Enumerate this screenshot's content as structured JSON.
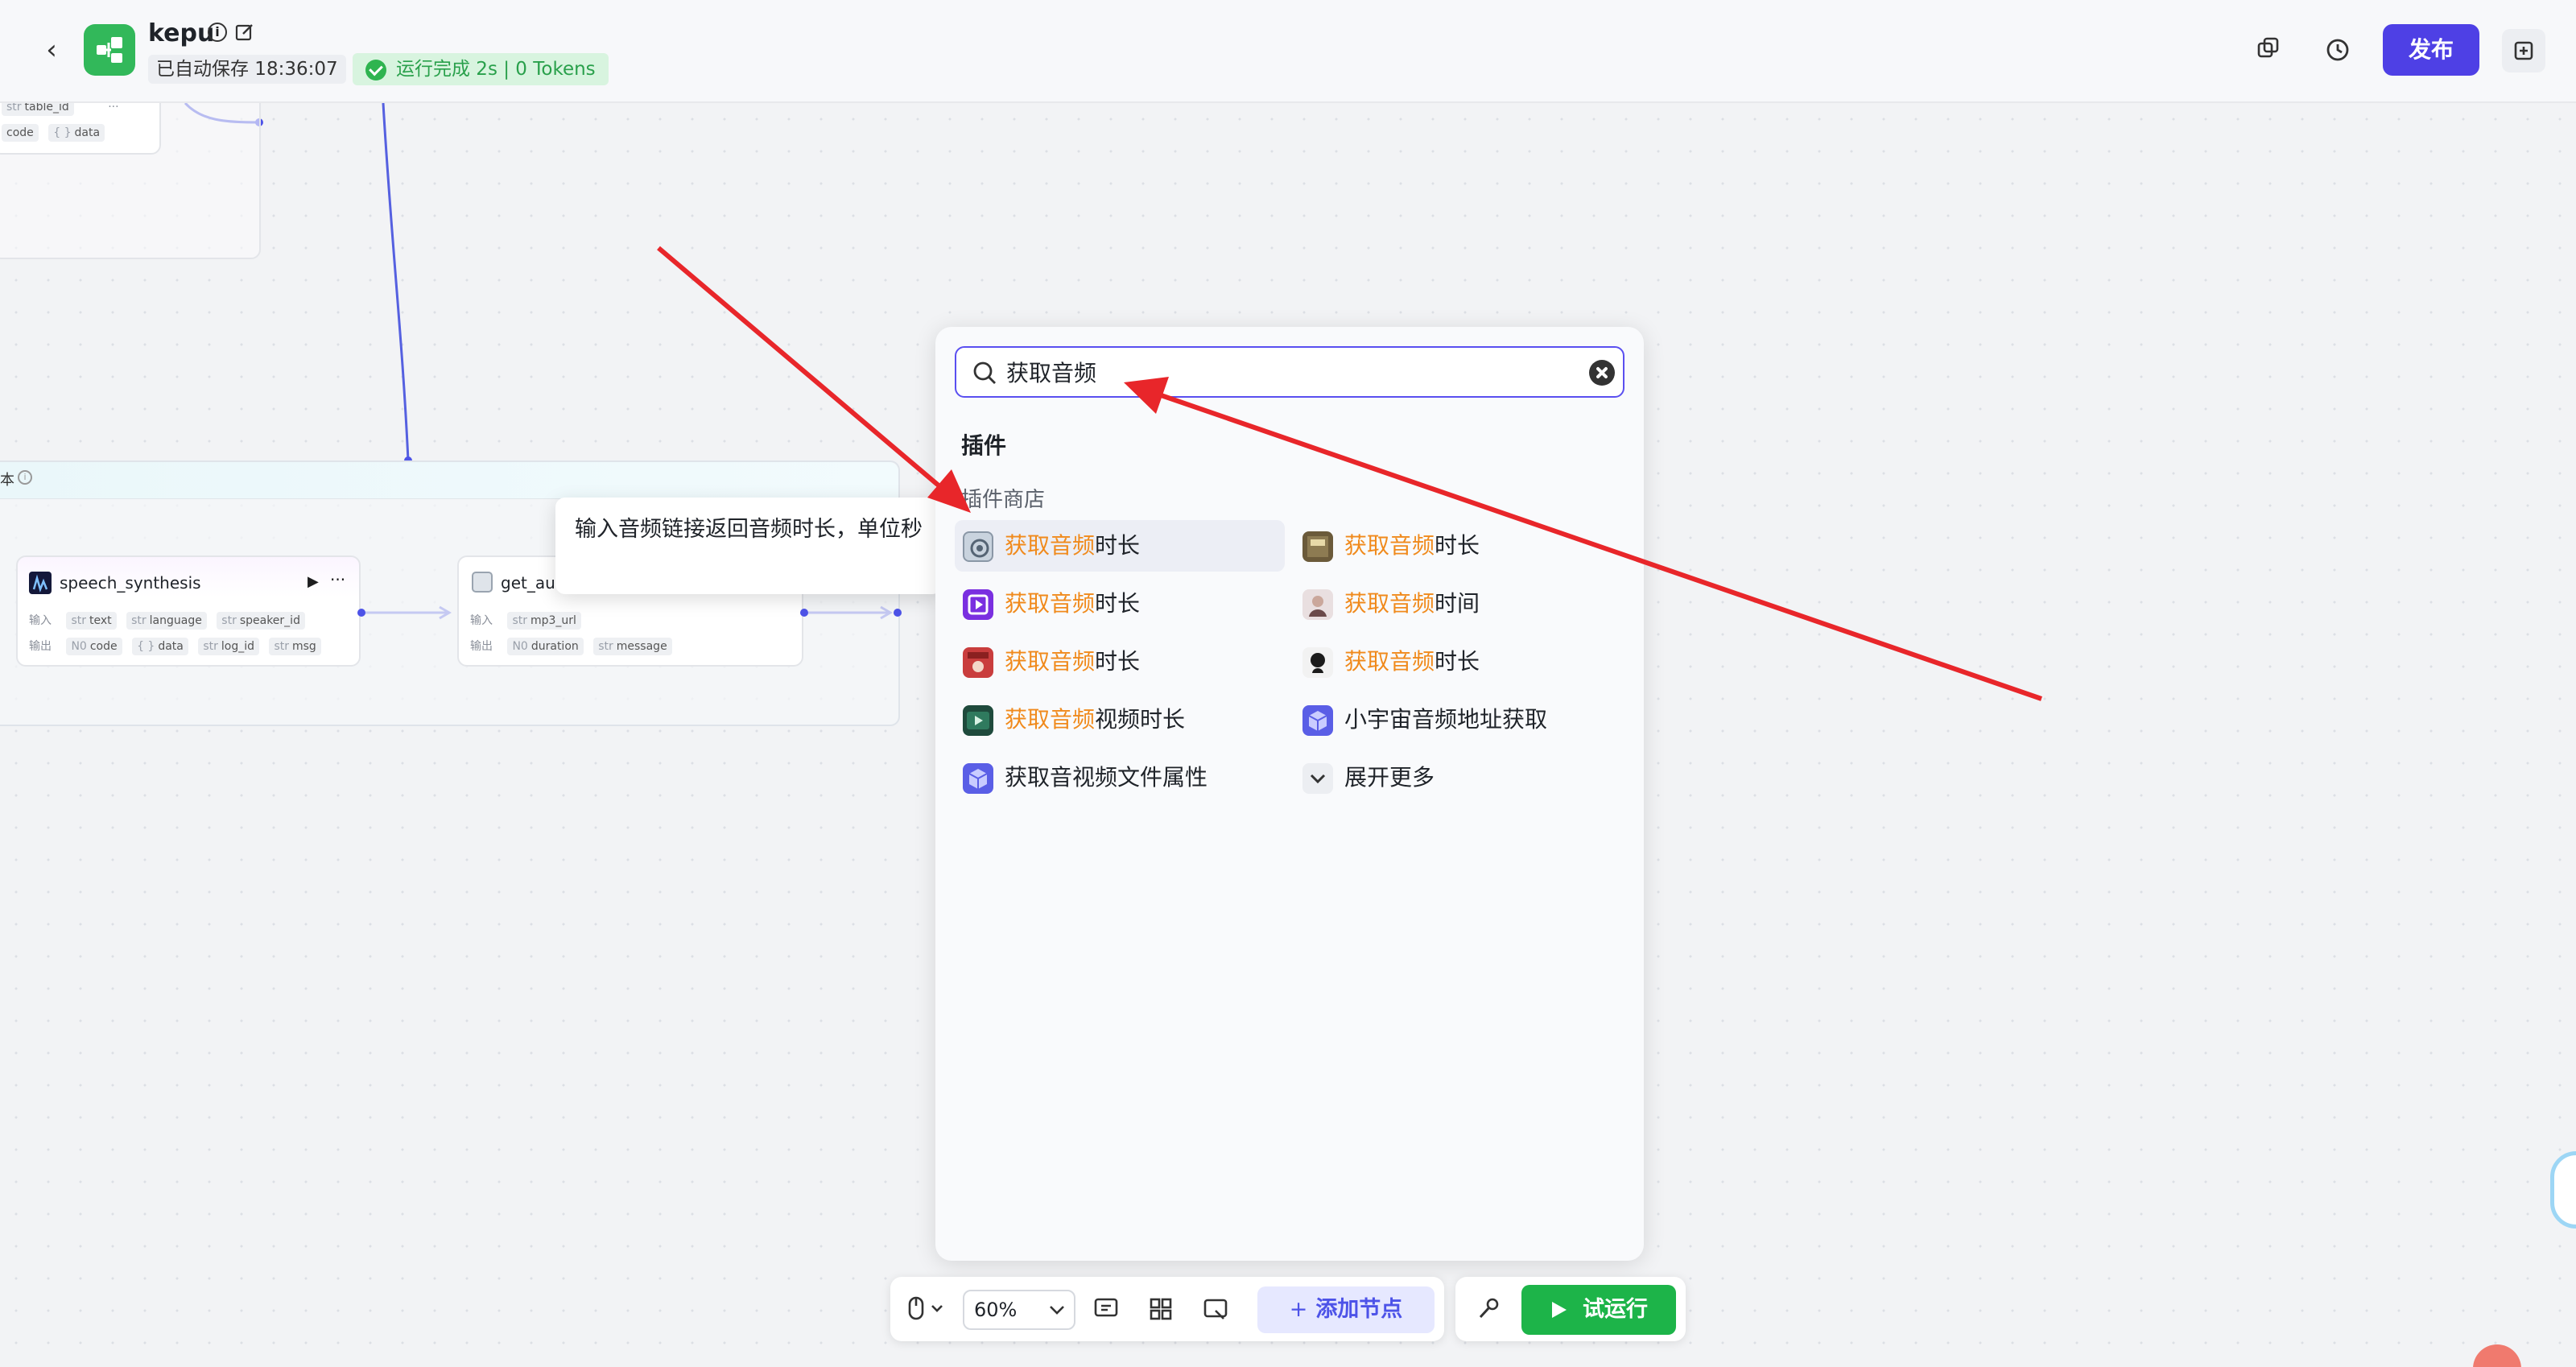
{
  "header": {
    "app_name": "kepu",
    "autosave_status": "已自动保存 18:36:07",
    "run_status": "运行完成 2s | 0 Tokens",
    "publish_label": "发布"
  },
  "canvas": {
    "top_node": {
      "row1_tags": [
        "table_id"
      ],
      "row2_tags": [
        "code",
        "data"
      ]
    },
    "loop_title": "本",
    "nodes": [
      {
        "title": "speech_synthesis",
        "input_label": "输入",
        "output_label": "输出",
        "inputs": [
          "text",
          "language",
          "speaker_id"
        ],
        "outputs": [
          "code",
          "data",
          "log_id",
          "msg"
        ]
      },
      {
        "title": "get_auc",
        "input_label": "输入",
        "output_label": "输出",
        "inputs": [
          "mp3_url"
        ],
        "outputs": [
          "duration",
          "message"
        ]
      }
    ]
  },
  "tooltip": {
    "text": "输入音频链接返回音频时长，单位秒"
  },
  "search_panel": {
    "query": "获取音频",
    "section_title": "插件",
    "subsection_title": "插件商店",
    "items": [
      {
        "highlight": "获取音频",
        "rest": "时长",
        "icon": "audio-chip-icon"
      },
      {
        "highlight": "获取音频",
        "rest": "时长",
        "icon": "media-tools-icon"
      },
      {
        "highlight": "获取音频",
        "rest": "时长",
        "icon": "purple-video-icon"
      },
      {
        "highlight": "获取音频",
        "rest": "时间",
        "icon": "portrait-icon"
      },
      {
        "highlight": "获取音频",
        "rest": "时长",
        "icon": "red-app-icon"
      },
      {
        "highlight": "获取音频",
        "rest": "时长",
        "icon": "dark-head-icon"
      },
      {
        "highlight": "获取音频",
        "rest": "视频时长",
        "icon": "green-video-icon"
      },
      {
        "highlight": "",
        "rest": "小宇宙音频地址获取",
        "icon": "cube-icon"
      },
      {
        "highlight": "",
        "rest": "获取音视频文件属性",
        "icon": "cube-icon"
      },
      {
        "highlight": "",
        "rest": "展开更多",
        "icon": "chevron-down-icon"
      }
    ]
  },
  "toolbar": {
    "zoom": "60%",
    "add_node_label": "添加节点",
    "test_run_label": "试运行"
  },
  "colors": {
    "accent": "#4e40e5",
    "highlight": "#f08a1c",
    "run_green": "#1db449",
    "annotation_red": "#e8262a"
  }
}
